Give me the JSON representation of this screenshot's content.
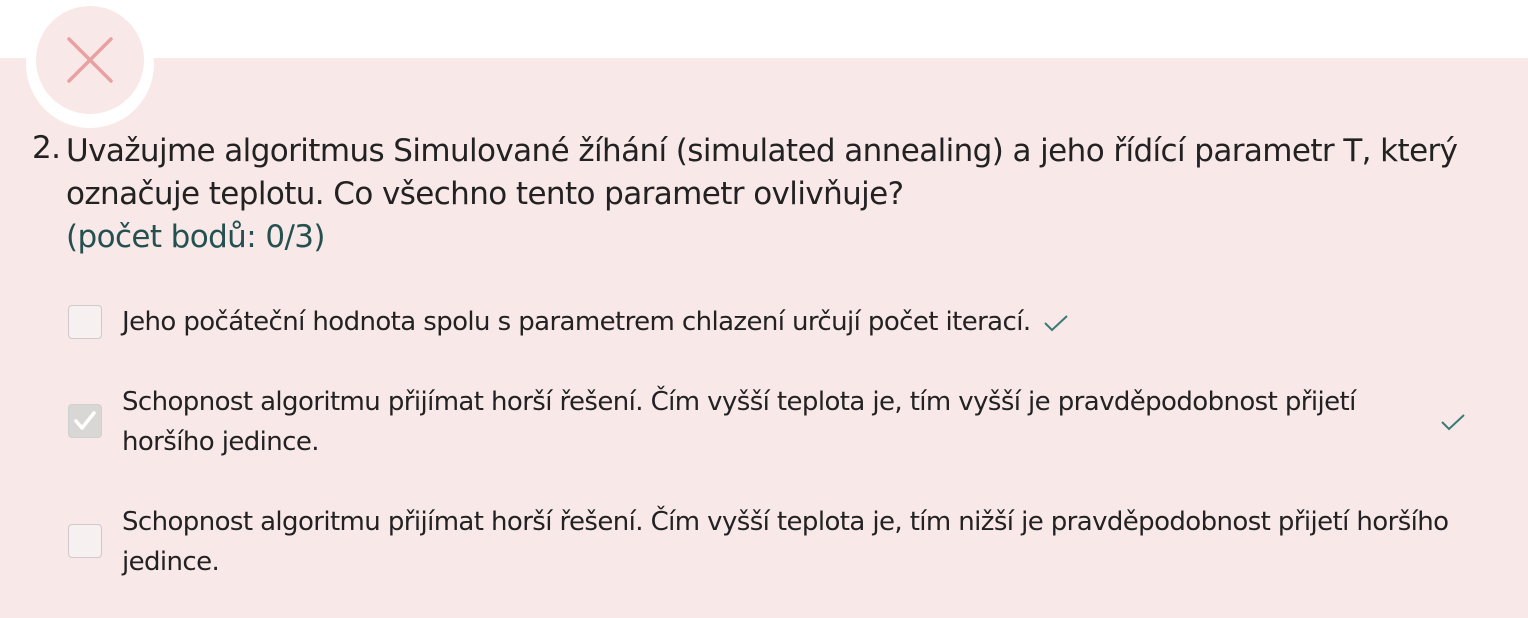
{
  "question": {
    "number": "2.",
    "text": "Uvažujme algoritmus Simulované žíhání (simulated annealing) a jeho řídící parametr T, který označuje teplotu. Co všechno tento parametr ovlivňuje?",
    "score": "(počet bodů: 0/3)",
    "status_icon": "close-icon"
  },
  "options": [
    {
      "text": "Jeho počáteční hodnota spolu s parametrem chlazení určují počet iterací.",
      "checked": false,
      "correct": true
    },
    {
      "text": "Schopnost algoritmu přijímat horší řešení. Čím vyšší teplota je, tím vyšší je pravděpodobnost přijetí horšího jedince.",
      "checked": true,
      "correct": true
    },
    {
      "text": "Schopnost algoritmu přijímat horší řešení. Čím vyšší teplota je, tím nižší je pravděpodobnost přijetí horšího jedince.",
      "checked": false,
      "correct": false
    }
  ],
  "colors": {
    "panel_bg": "#f9e8e8",
    "wrong_x": "#e8a0a0",
    "tick": "#3a7a75",
    "score": "#24504f"
  }
}
